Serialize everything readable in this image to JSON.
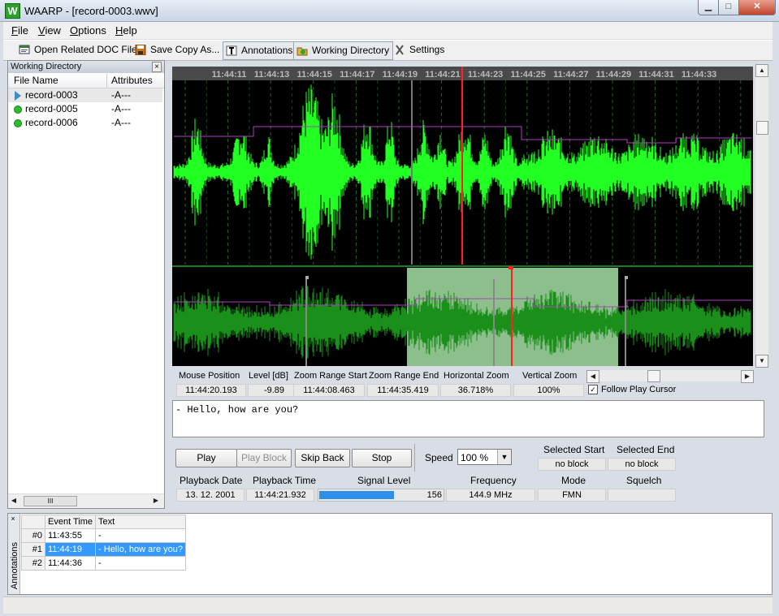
{
  "window": {
    "title": "WAARP - [record-0003.wwv]",
    "icon_letter": "W"
  },
  "menu": [
    {
      "label": "File",
      "key": "F",
      "rest": "ile"
    },
    {
      "label": "View",
      "key": "V",
      "rest": "iew"
    },
    {
      "label": "Options",
      "key": "O",
      "rest": "ptions"
    },
    {
      "label": "Help",
      "key": "H",
      "rest": "elp"
    }
  ],
  "toolbar": {
    "open_doc": "Open Related DOC File",
    "save_copy": "Save Copy As...",
    "annotations": "Annotations",
    "working_dir": "Working Directory",
    "settings": "Settings"
  },
  "working_directory": {
    "title": "Working Directory",
    "columns": [
      "File Name",
      "Attributes"
    ],
    "files": [
      {
        "name": "record-0003",
        "attr": "-A---",
        "status": "playing"
      },
      {
        "name": "record-0005",
        "attr": "-A---",
        "status": "ok"
      },
      {
        "name": "record-0006",
        "attr": "-A---",
        "status": "ok"
      }
    ]
  },
  "timeline_ticks": [
    "11:44:11",
    "11:44:13",
    "11:44:15",
    "11:44:17",
    "11:44:19",
    "11:44:21",
    "11:44:23",
    "11:44:25",
    "11:44:27",
    "11:44:29",
    "11:44:31",
    "11:44:33"
  ],
  "colors": {
    "waveform": "#22ff22",
    "overview_waveform": "#1a8f1a",
    "level_line": "#b040c0",
    "cursor": "#ff2020",
    "selection": "#8cbf8c"
  },
  "info": {
    "mouse_position": {
      "label": "Mouse Position",
      "value": "11:44:20.193"
    },
    "level": {
      "label": "Level [dB]",
      "value": "-9.89"
    },
    "zoom_start": {
      "label": "Zoom Range Start",
      "value": "11:44:08.463"
    },
    "zoom_end": {
      "label": "Zoom Range End",
      "value": "11:44:35.419"
    },
    "h_zoom": {
      "label": "Horizontal Zoom",
      "value": "36.718%"
    },
    "v_zoom": {
      "label": "Vertical Zoom",
      "value": "100%"
    },
    "follow_cursor": "Follow Play Cursor"
  },
  "annotation_text": "- Hello, how are you?",
  "controls": {
    "play": "Play",
    "play_block": "Play Block",
    "skip_back": "Skip Back",
    "stop": "Stop",
    "speed_label": "Speed",
    "speed_value": "100 %",
    "selected_start_label": "Selected Start",
    "selected_start": "no block",
    "selected_end_label": "Selected End",
    "selected_end": "no block"
  },
  "status": {
    "playback_date_label": "Playback Date",
    "playback_date": "13. 12. 2001",
    "playback_time_label": "Playback Time",
    "playback_time": "11:44:21.932",
    "signal_level_label": "Signal Level",
    "signal_level": "156",
    "signal_fraction": 0.61,
    "frequency_label": "Frequency",
    "frequency": "144.9 MHz",
    "mode_label": "Mode",
    "mode": "FMN",
    "squelch_label": "Squelch",
    "squelch": ""
  },
  "annotations": {
    "side_label": "Annotations",
    "columns": [
      "Event Time",
      "Text"
    ],
    "rows": [
      {
        "idx": "#0",
        "time": "11:43:55",
        "text": "-"
      },
      {
        "idx": "#1",
        "time": "11:44:19",
        "text": "- Hello, how are you?"
      },
      {
        "idx": "#2",
        "time": "11:44:36",
        "text": "-"
      }
    ]
  }
}
